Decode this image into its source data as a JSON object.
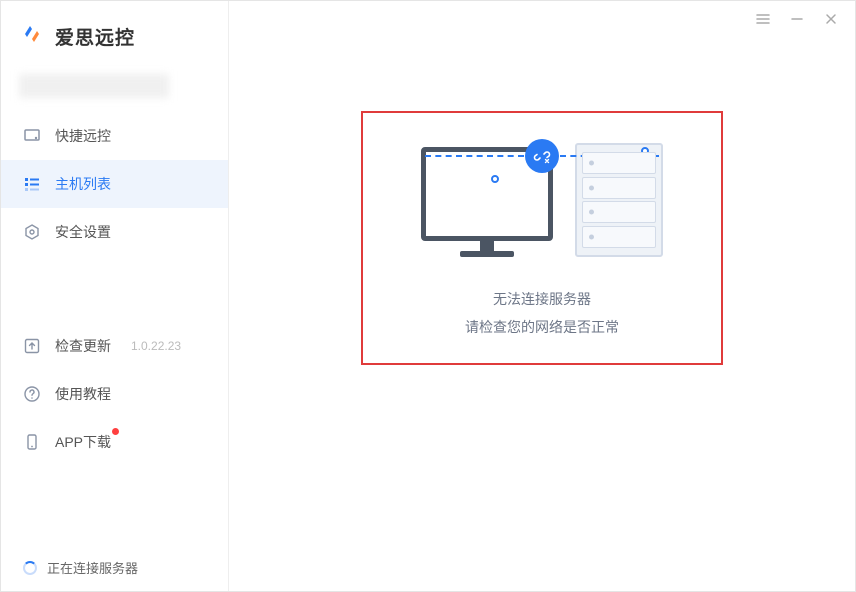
{
  "app": {
    "title": "爱思远控"
  },
  "sidebar": {
    "items": [
      {
        "label": "快捷远控"
      },
      {
        "label": "主机列表"
      },
      {
        "label": "安全设置"
      }
    ],
    "bottom": [
      {
        "label": "检查更新",
        "version": "1.0.22.23"
      },
      {
        "label": "使用教程"
      },
      {
        "label": "APP下载"
      }
    ]
  },
  "status": {
    "label": "正在连接服务器"
  },
  "error": {
    "line1": "无法连接服务器",
    "line2": "请检查您的网络是否正常"
  }
}
